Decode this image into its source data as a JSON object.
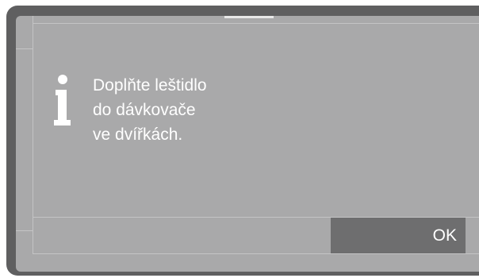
{
  "dialog": {
    "icon": "info-icon",
    "message_lines": [
      "Doplňte leštidlo",
      "do dávkovače",
      "ve dvířkách."
    ],
    "ok_label": "OK"
  },
  "colors": {
    "bezel": "#5f5f60",
    "screen": "#a9a9aa",
    "frame": "#c4c4c5",
    "ok_button": "#6e6e6f",
    "text": "#ffffff"
  }
}
